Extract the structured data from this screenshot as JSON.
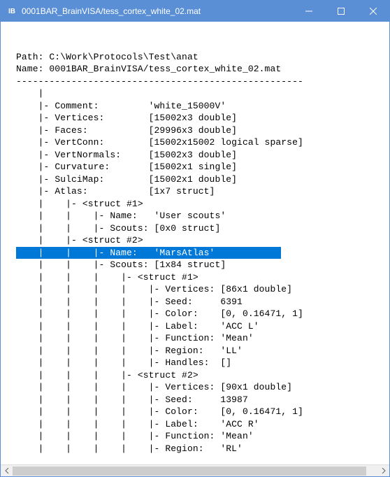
{
  "titlebar": {
    "icon_text": "IB",
    "title": "0001BAR_BrainVISA/tess_cortex_white_02.mat"
  },
  "header": {
    "path_label": "Path: C:\\Work\\Protocols\\Test\\anat",
    "name_label": "Name: 0001BAR_BrainVISA/tess_cortex_white_02.mat",
    "separator": "----------------------------------------------------"
  },
  "lines": {
    "l01": "|",
    "l02": "|- Comment:         'white_15000V'",
    "l03": "|- Vertices:        [15002x3 double]",
    "l04": "|- Faces:           [29996x3 double]",
    "l05": "|- VertConn:        [15002x15002 logical sparse]",
    "l06": "|- VertNormals:     [15002x3 double]",
    "l07": "|- Curvature:       [15002x1 single]",
    "l08": "|- SulciMap:        [15002x1 double]",
    "l09": "|- Atlas:           [1x7 struct]",
    "l10": "|    |- <struct #1>",
    "l11": "|    |    |- Name:   'User scouts'",
    "l12": "|    |    |- Scouts: [0x0 struct]",
    "l13": "|    |- <struct #2>",
    "l14a": "|    |    |- Name:   'MarsAtlas'",
    "l15": "|    |    |- Scouts: [1x84 struct]",
    "l16": "|    |    |    |- <struct #1>",
    "l17": "|    |    |    |    |- Vertices: [86x1 double]",
    "l18": "|    |    |    |    |- Seed:     6391",
    "l19": "|    |    |    |    |- Color:    [0, 0.16471, 1]",
    "l20": "|    |    |    |    |- Label:    'ACC L'",
    "l21": "|    |    |    |    |- Function: 'Mean'",
    "l22": "|    |    |    |    |- Region:   'LL'",
    "l23": "|    |    |    |    |- Handles:  []",
    "l24": "|    |    |    |- <struct #2>",
    "l25": "|    |    |    |    |- Vertices: [90x1 double]",
    "l26": "|    |    |    |    |- Seed:     13987",
    "l27": "|    |    |    |    |- Color:    [0, 0.16471, 1]",
    "l28": "|    |    |    |    |- Label:    'ACC R'",
    "l29": "|    |    |    |    |- Function: 'Mean'",
    "l30": "|    |    |    |    |- Region:   'RL'"
  }
}
